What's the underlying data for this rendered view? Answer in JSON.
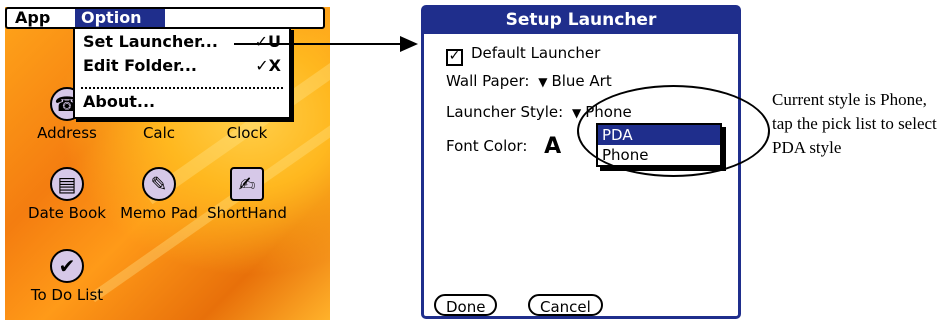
{
  "launcher": {
    "menu": {
      "app_label": "App",
      "option_label": "Option",
      "items": [
        {
          "label": "Set Launcher...",
          "shortcut": "✓U"
        },
        {
          "label": "Edit Folder...",
          "shortcut": "✓X"
        },
        {
          "label": "About...",
          "shortcut": ""
        }
      ]
    },
    "apps": [
      {
        "label": "Address",
        "icon": "address-icon"
      },
      {
        "label": "Calc",
        "icon": "calc-icon"
      },
      {
        "label": "Clock",
        "icon": "clock-icon"
      },
      {
        "label": "Date Book",
        "icon": "date-book-icon"
      },
      {
        "label": "Memo Pad",
        "icon": "memo-pad-icon"
      },
      {
        "label": "ShortHand",
        "icon": "shorthand-icon"
      },
      {
        "label": "To Do List",
        "icon": "to-do-list-icon"
      }
    ]
  },
  "dialog": {
    "title": "Setup Launcher",
    "default_launcher_label": "Default Launcher",
    "default_launcher_checked": true,
    "wallpaper_label": "Wall Paper:",
    "wallpaper_value": "Blue Art",
    "launcher_style_label": "Launcher Style:",
    "launcher_style_value": "Phone",
    "font_color_label": "Font Color:",
    "font_color_sample": "A",
    "picklist_options": [
      "PDA",
      "Phone"
    ],
    "picklist_selected": "PDA",
    "done_label": "Done",
    "cancel_label": "Cancel"
  },
  "annotation": "Current style is Phone, tap the pick list to select PDA style",
  "colors": {
    "title_bar": "#1f2e8c",
    "wallpaper": "#f47d10"
  }
}
